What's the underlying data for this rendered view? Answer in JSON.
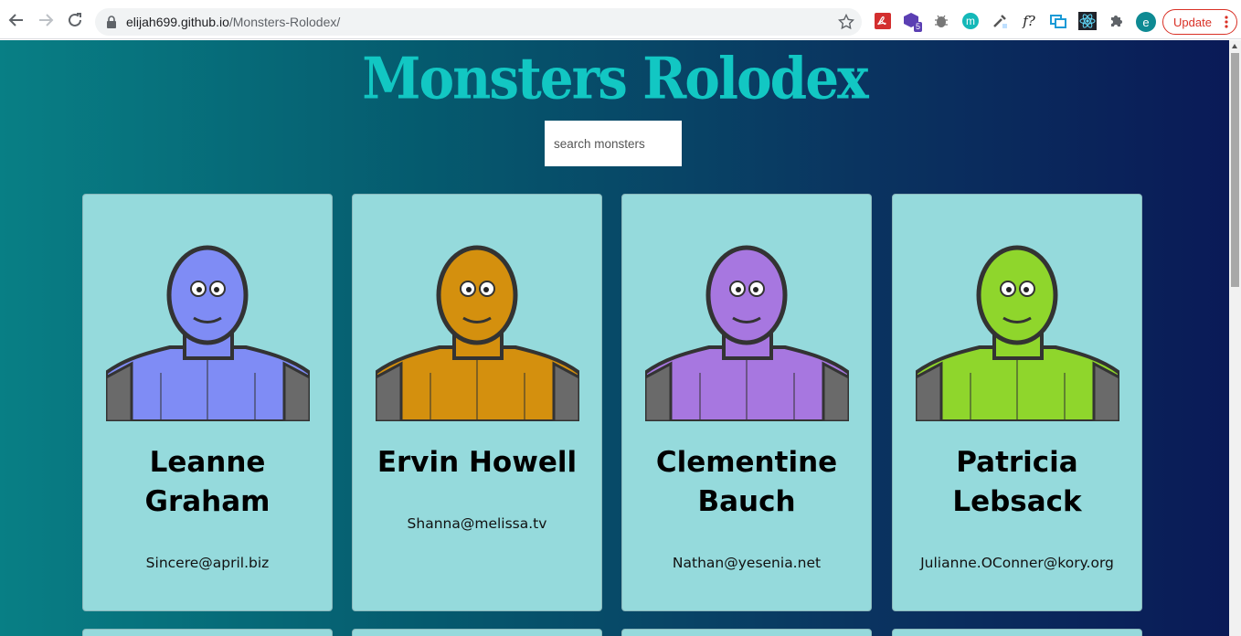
{
  "browser": {
    "url_host": "elijah699.github.io",
    "url_path": "/Monsters-Rolodex/",
    "update_label": "Update",
    "profile_initial": "e",
    "ext_badge": "5",
    "ext_f_label": "f?",
    "ext_m_label": "m"
  },
  "page": {
    "title": "Monsters Rolodex",
    "search_placeholder": "search monsters"
  },
  "monsters": [
    {
      "name": "Leanne Graham",
      "email": "Sincere@april.biz",
      "color": "#7f8cf5"
    },
    {
      "name": "Ervin Howell",
      "email": "Shanna@melissa.tv",
      "color": "#d4900e"
    },
    {
      "name": "Clementine Bauch",
      "email": "Nathan@yesenia.net",
      "color": "#a777e0"
    },
    {
      "name": "Patricia Lebsack",
      "email": "Julianne.OConner@kory.org",
      "color": "#8fd62c"
    }
  ]
}
